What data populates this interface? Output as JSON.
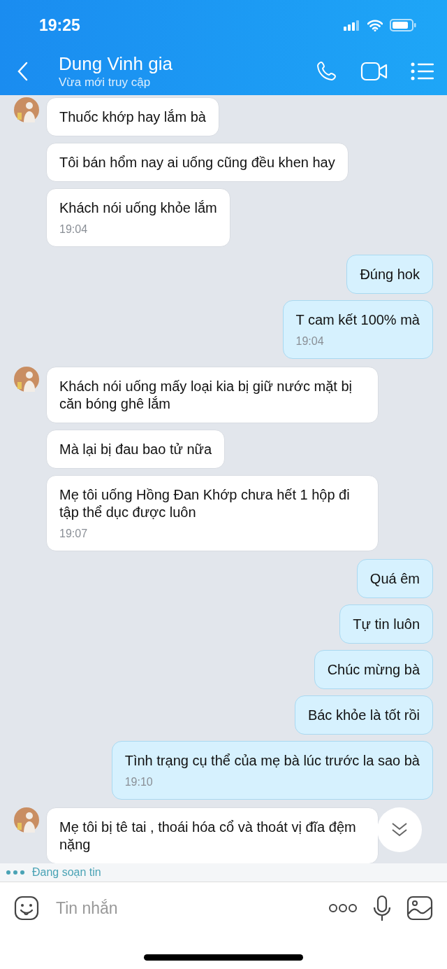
{
  "status_bar": {
    "time": "19:25"
  },
  "header": {
    "title": "Dung Vinh gia",
    "subtitle": "Vừa mới truy cập"
  },
  "messages": [
    {
      "kind": "incoming",
      "show_avatar": true,
      "text": "Thuốc khớp hay lắm bà"
    },
    {
      "kind": "incoming",
      "show_avatar": false,
      "text": "Tôi bán hổm nay ai uống cũng đều khen hay"
    },
    {
      "kind": "incoming",
      "show_avatar": false,
      "text": "Khách nói uống khỏe lắm",
      "time": "19:04"
    },
    {
      "kind": "outgoing",
      "text": "Đúng hok"
    },
    {
      "kind": "outgoing",
      "text": "T cam kết 100% mà",
      "time": "19:04"
    },
    {
      "kind": "incoming",
      "show_avatar": true,
      "text": "Khách nói uống mấy loại kia bị giữ nước mặt bị căn bóng ghê lắm"
    },
    {
      "kind": "incoming",
      "show_avatar": false,
      "text": "Mà lại bị đau bao tử nữa"
    },
    {
      "kind": "incoming",
      "show_avatar": false,
      "text": "Mẹ tôi uống Hồng Đan Khớp chưa hết 1 hộp đi tập thể dục được luôn",
      "time": "19:07"
    },
    {
      "kind": "outgoing",
      "text": "Quá êm"
    },
    {
      "kind": "outgoing",
      "text": "Tự tin luôn"
    },
    {
      "kind": "outgoing",
      "text": "Chúc mừng bà"
    },
    {
      "kind": "outgoing",
      "text": "Bác khỏe là tốt rồi"
    },
    {
      "kind": "outgoing",
      "text": "Tình trạng cụ thể của mẹ bà lúc trước la sao bà",
      "time": "19:10"
    },
    {
      "kind": "incoming",
      "show_avatar": true,
      "text": "Mẹ tôi bị tê tai , thoái hóa cổ và thoát vị đĩa đệm nặng"
    }
  ],
  "typing": {
    "text": "Đang soạn tin"
  },
  "composer": {
    "placeholder": "Tin nhắn"
  }
}
